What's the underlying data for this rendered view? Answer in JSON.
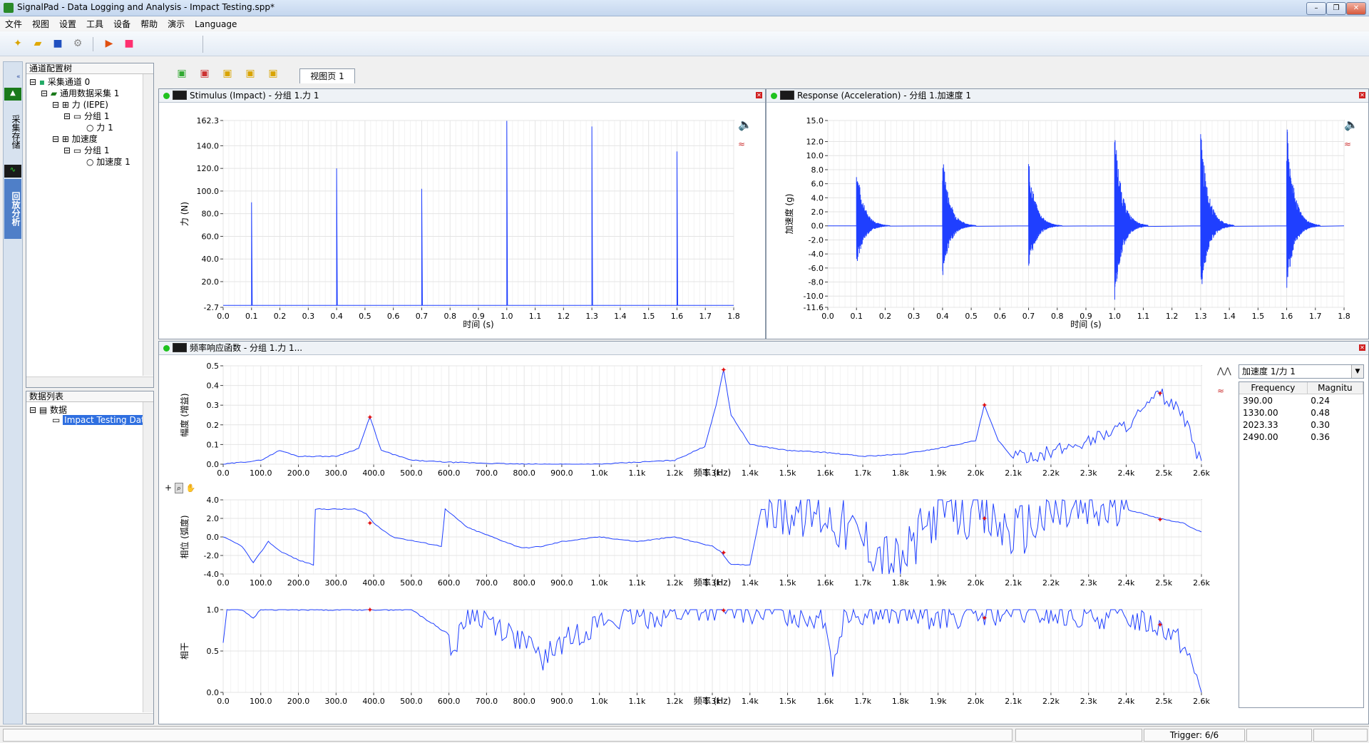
{
  "window": {
    "title": "SignalPad - Data Logging and Analysis - Impact Testing.spp*"
  },
  "menu": [
    "文件",
    "视图",
    "设置",
    "工具",
    "设备",
    "帮助",
    "演示",
    "Language"
  ],
  "left_strip": {
    "tab_acquire": "采集存储",
    "tab_playback": "回放分析"
  },
  "channel_tree": {
    "title": "通道配置树",
    "items": [
      "采集通道 0",
      "通用数据采集 1",
      "力 (IEPE)",
      "分组 1",
      "力 1",
      "加速度",
      "分组 1",
      "加速度 1"
    ]
  },
  "data_list": {
    "title": "数据列表",
    "items": [
      "数据",
      "Impact Testing Dat"
    ]
  },
  "view_tab": "视图页 1",
  "stimulus": {
    "title": "Stimulus (Impact) - 分组 1.力 1"
  },
  "response": {
    "title": "Response (Acceleration) - 分组 1.加速度 1"
  },
  "frf": {
    "title": "频率响应函数 - 分组 1.力 1...",
    "channel_select": "加速度 1/力 1"
  },
  "marker_table": {
    "headers": [
      "Frequency",
      "Magnitu"
    ],
    "rows": [
      [
        "390.00",
        "0.24"
      ],
      [
        "1330.00",
        "0.48"
      ],
      [
        "2023.33",
        "0.30"
      ],
      [
        "2490.00",
        "0.36"
      ]
    ]
  },
  "status": {
    "trigger": "Trigger: 6/6"
  },
  "chart_data": [
    {
      "type": "line",
      "ylabel": "力 (N)",
      "xlabel": "时间 (s)",
      "xlim": [
        0.0,
        1.8
      ],
      "ylim": [
        -2.7,
        162.3
      ],
      "yticks": [
        "162.3",
        "140.0",
        "120.0",
        "100.0",
        "80.0",
        "60.0",
        "40.0",
        "20.0",
        "-2.7"
      ],
      "ytick_values": [
        162.3,
        140,
        120,
        100,
        80,
        60,
        40,
        20,
        -2.7
      ],
      "xticks": [
        "0.0",
        "0.1",
        "0.2",
        "0.3",
        "0.4",
        "0.5",
        "0.6",
        "0.7",
        "0.8",
        "0.9",
        "1.0",
        "1.1",
        "1.2",
        "1.3",
        "1.4",
        "1.5",
        "1.6",
        "1.7",
        "1.8"
      ],
      "series": [
        {
          "impulse_times": [
            0.1,
            0.4,
            0.7,
            1.0,
            1.3,
            1.6
          ],
          "peak_values": [
            90,
            120,
            102,
            162,
            157,
            135
          ]
        }
      ],
      "color": "#1f3fff",
      "grid": true
    },
    {
      "type": "line",
      "ylabel": "加速度 (g)",
      "xlabel": "时间 (s)",
      "xlim": [
        0.0,
        1.8
      ],
      "ylim": [
        -11.6,
        15.0
      ],
      "yticks": [
        "15.0",
        "12.0",
        "10.0",
        "8.0",
        "6.0",
        "4.0",
        "2.0",
        "0.0",
        "-2.0",
        "-4.0",
        "-6.0",
        "-8.0",
        "-10.0",
        "-11.6"
      ],
      "ytick_values": [
        15,
        12,
        10,
        8,
        6,
        4,
        2,
        0,
        -2,
        -4,
        -6,
        -8,
        -10,
        -11.6
      ],
      "xticks": [
        "0.0",
        "0.1",
        "0.2",
        "0.3",
        "0.4",
        "0.5",
        "0.6",
        "0.7",
        "0.8",
        "0.9",
        "1.0",
        "1.1",
        "1.2",
        "1.3",
        "1.4",
        "1.5",
        "1.6",
        "1.7",
        "1.8"
      ],
      "series": [
        {
          "impact_times": [
            0.1,
            0.4,
            0.7,
            1.0,
            1.3,
            1.6
          ],
          "peak_values": [
            9,
            10.5,
            9.5,
            14.2,
            14.4,
            15.0
          ],
          "trough_values": [
            -6,
            -7.5,
            -6.5,
            -11,
            -10.5,
            -9.5
          ]
        }
      ],
      "color": "#1f3fff",
      "grid": true
    },
    {
      "type": "line",
      "ylabel": "幅度 (增益)",
      "xlabel": "频率 (Hz)",
      "xlim": [
        0,
        2600
      ],
      "ylim": [
        0,
        0.5
      ],
      "yticks": [
        "0.5",
        "0.4",
        "0.3",
        "0.2",
        "0.1",
        "0.0"
      ],
      "ytick_values": [
        0.5,
        0.4,
        0.3,
        0.2,
        0.1,
        0.0
      ],
      "xticks": [
        "0.0",
        "100.0",
        "200.0",
        "300.0",
        "400.0",
        "500.0",
        "600.0",
        "700.0",
        "800.0",
        "900.0",
        "1.0k",
        "1.1k",
        "1.2k",
        "1.3k",
        "1.4k",
        "1.5k",
        "1.6k",
        "1.7k",
        "1.8k",
        "1.9k",
        "2.0k",
        "2.1k",
        "2.2k",
        "2.3k",
        "2.4k",
        "2.5k",
        "2.6k"
      ],
      "series": [
        {
          "x": [
            0,
            100,
            150,
            200,
            300,
            360,
            390,
            420,
            500,
            600,
            800,
            1000,
            1200,
            1280,
            1310,
            1330,
            1350,
            1400,
            1500,
            1600,
            1700,
            1800,
            1900,
            2000,
            2023,
            2060,
            2100,
            2200,
            2300,
            2400,
            2450,
            2490,
            2550,
            2600
          ],
          "y": [
            0.0,
            0.02,
            0.07,
            0.04,
            0.04,
            0.08,
            0.24,
            0.07,
            0.02,
            0.01,
            0.0,
            0.0,
            0.02,
            0.09,
            0.3,
            0.48,
            0.25,
            0.1,
            0.07,
            0.06,
            0.04,
            0.05,
            0.08,
            0.12,
            0.3,
            0.12,
            0.03,
            0.06,
            0.12,
            0.2,
            0.28,
            0.36,
            0.25,
            0.0
          ]
        }
      ],
      "markers": [
        {
          "x": 390,
          "y": 0.24
        },
        {
          "x": 1330,
          "y": 0.48
        },
        {
          "x": 2023.33,
          "y": 0.3
        },
        {
          "x": 2490,
          "y": 0.36
        }
      ],
      "color": "#1f3fff",
      "grid": true
    },
    {
      "type": "line",
      "ylabel": "相位 (弧度)",
      "xlabel": "频率 (Hz)",
      "xlim": [
        0,
        2600
      ],
      "ylim": [
        -4.0,
        4.0
      ],
      "yticks": [
        "4.0",
        "2.0",
        "0.0",
        "-2.0",
        "-4.0"
      ],
      "ytick_values": [
        4,
        2,
        0,
        -2,
        -4
      ],
      "xticks": [
        "0.0",
        "100.0",
        "200.0",
        "300.0",
        "400.0",
        "500.0",
        "600.0",
        "700.0",
        "800.0",
        "900.0",
        "1.0k",
        "1.1k",
        "1.2k",
        "1.3k",
        "1.4k",
        "1.5k",
        "1.6k",
        "1.7k",
        "1.8k",
        "1.9k",
        "2.0k",
        "2.1k",
        "2.2k",
        "2.3k",
        "2.4k",
        "2.5k",
        "2.6k"
      ],
      "series": [
        {
          "x": [
            0,
            50,
            80,
            120,
            150,
            200,
            240,
            245,
            350,
            380,
            400,
            450,
            580,
            590,
            650,
            780,
            800,
            850,
            900,
            1000,
            1100,
            1200,
            1300,
            1320,
            1350,
            1400,
            1430,
            1440,
            1600,
            1800,
            1900,
            2023,
            2100,
            2200,
            2400,
            2490,
            2550,
            2600
          ],
          "y": [
            0,
            -1,
            -2.8,
            -0.5,
            -1.5,
            -2.5,
            -3,
            3,
            3,
            2.5,
            1.5,
            0,
            -1,
            3,
            1,
            -1,
            -1.2,
            -1,
            -0.5,
            0,
            -0.5,
            0,
            -1,
            -1.5,
            -3,
            -3,
            3,
            3,
            2.5,
            -3,
            3,
            2,
            0.5,
            2.5,
            3,
            2,
            1.5,
            0.5
          ]
        }
      ],
      "markers": [
        {
          "x": 390,
          "y": 1.5
        },
        {
          "x": 1330,
          "y": -1.7
        },
        {
          "x": 2023.33,
          "y": 2.0
        },
        {
          "x": 2490,
          "y": 1.9
        }
      ],
      "color": "#1f3fff",
      "grid": true
    },
    {
      "type": "line",
      "ylabel": "相干",
      "xlabel": "频率 (Hz)",
      "xlim": [
        0,
        2600
      ],
      "ylim": [
        0,
        1.0
      ],
      "yticks": [
        "1.0",
        "0.5",
        "0.0"
      ],
      "ytick_values": [
        1.0,
        0.5,
        0.0
      ],
      "xticks": [
        "0.0",
        "100.0",
        "200.0",
        "300.0",
        "400.0",
        "500.0",
        "600.0",
        "700.0",
        "800.0",
        "900.0",
        "1.0k",
        "1.1k",
        "1.2k",
        "1.3k",
        "1.4k",
        "1.5k",
        "1.6k",
        "1.7k",
        "1.8k",
        "1.9k",
        "2.0k",
        "2.1k",
        "2.2k",
        "2.3k",
        "2.4k",
        "2.5k",
        "2.6k"
      ],
      "series": [
        {
          "x": [
            0,
            10,
            50,
            80,
            100,
            500,
            600,
            610,
            650,
            700,
            800,
            850,
            900,
            1000,
            1100,
            1200,
            1300,
            1400,
            1500,
            1600,
            1620,
            1650,
            1700,
            1800,
            1900,
            2000,
            2100,
            2200,
            2300,
            2400,
            2500,
            2550,
            2600
          ],
          "y": [
            0.6,
            1.0,
            1.0,
            0.9,
            1.0,
            1.0,
            0.7,
            0.45,
            0.95,
            0.9,
            0.6,
            0.4,
            0.6,
            0.85,
            0.9,
            0.95,
            1.0,
            0.97,
            0.95,
            0.9,
            0.3,
            0.95,
            0.96,
            0.95,
            0.9,
            0.92,
            0.95,
            0.93,
            0.9,
            0.92,
            0.8,
            0.6,
            0.05
          ]
        }
      ],
      "markers": [
        {
          "x": 390,
          "y": 1.0
        },
        {
          "x": 1330,
          "y": 0.99
        },
        {
          "x": 2023.33,
          "y": 0.9
        },
        {
          "x": 2490,
          "y": 0.82
        }
      ],
      "color": "#1f3fff",
      "grid": true
    }
  ]
}
